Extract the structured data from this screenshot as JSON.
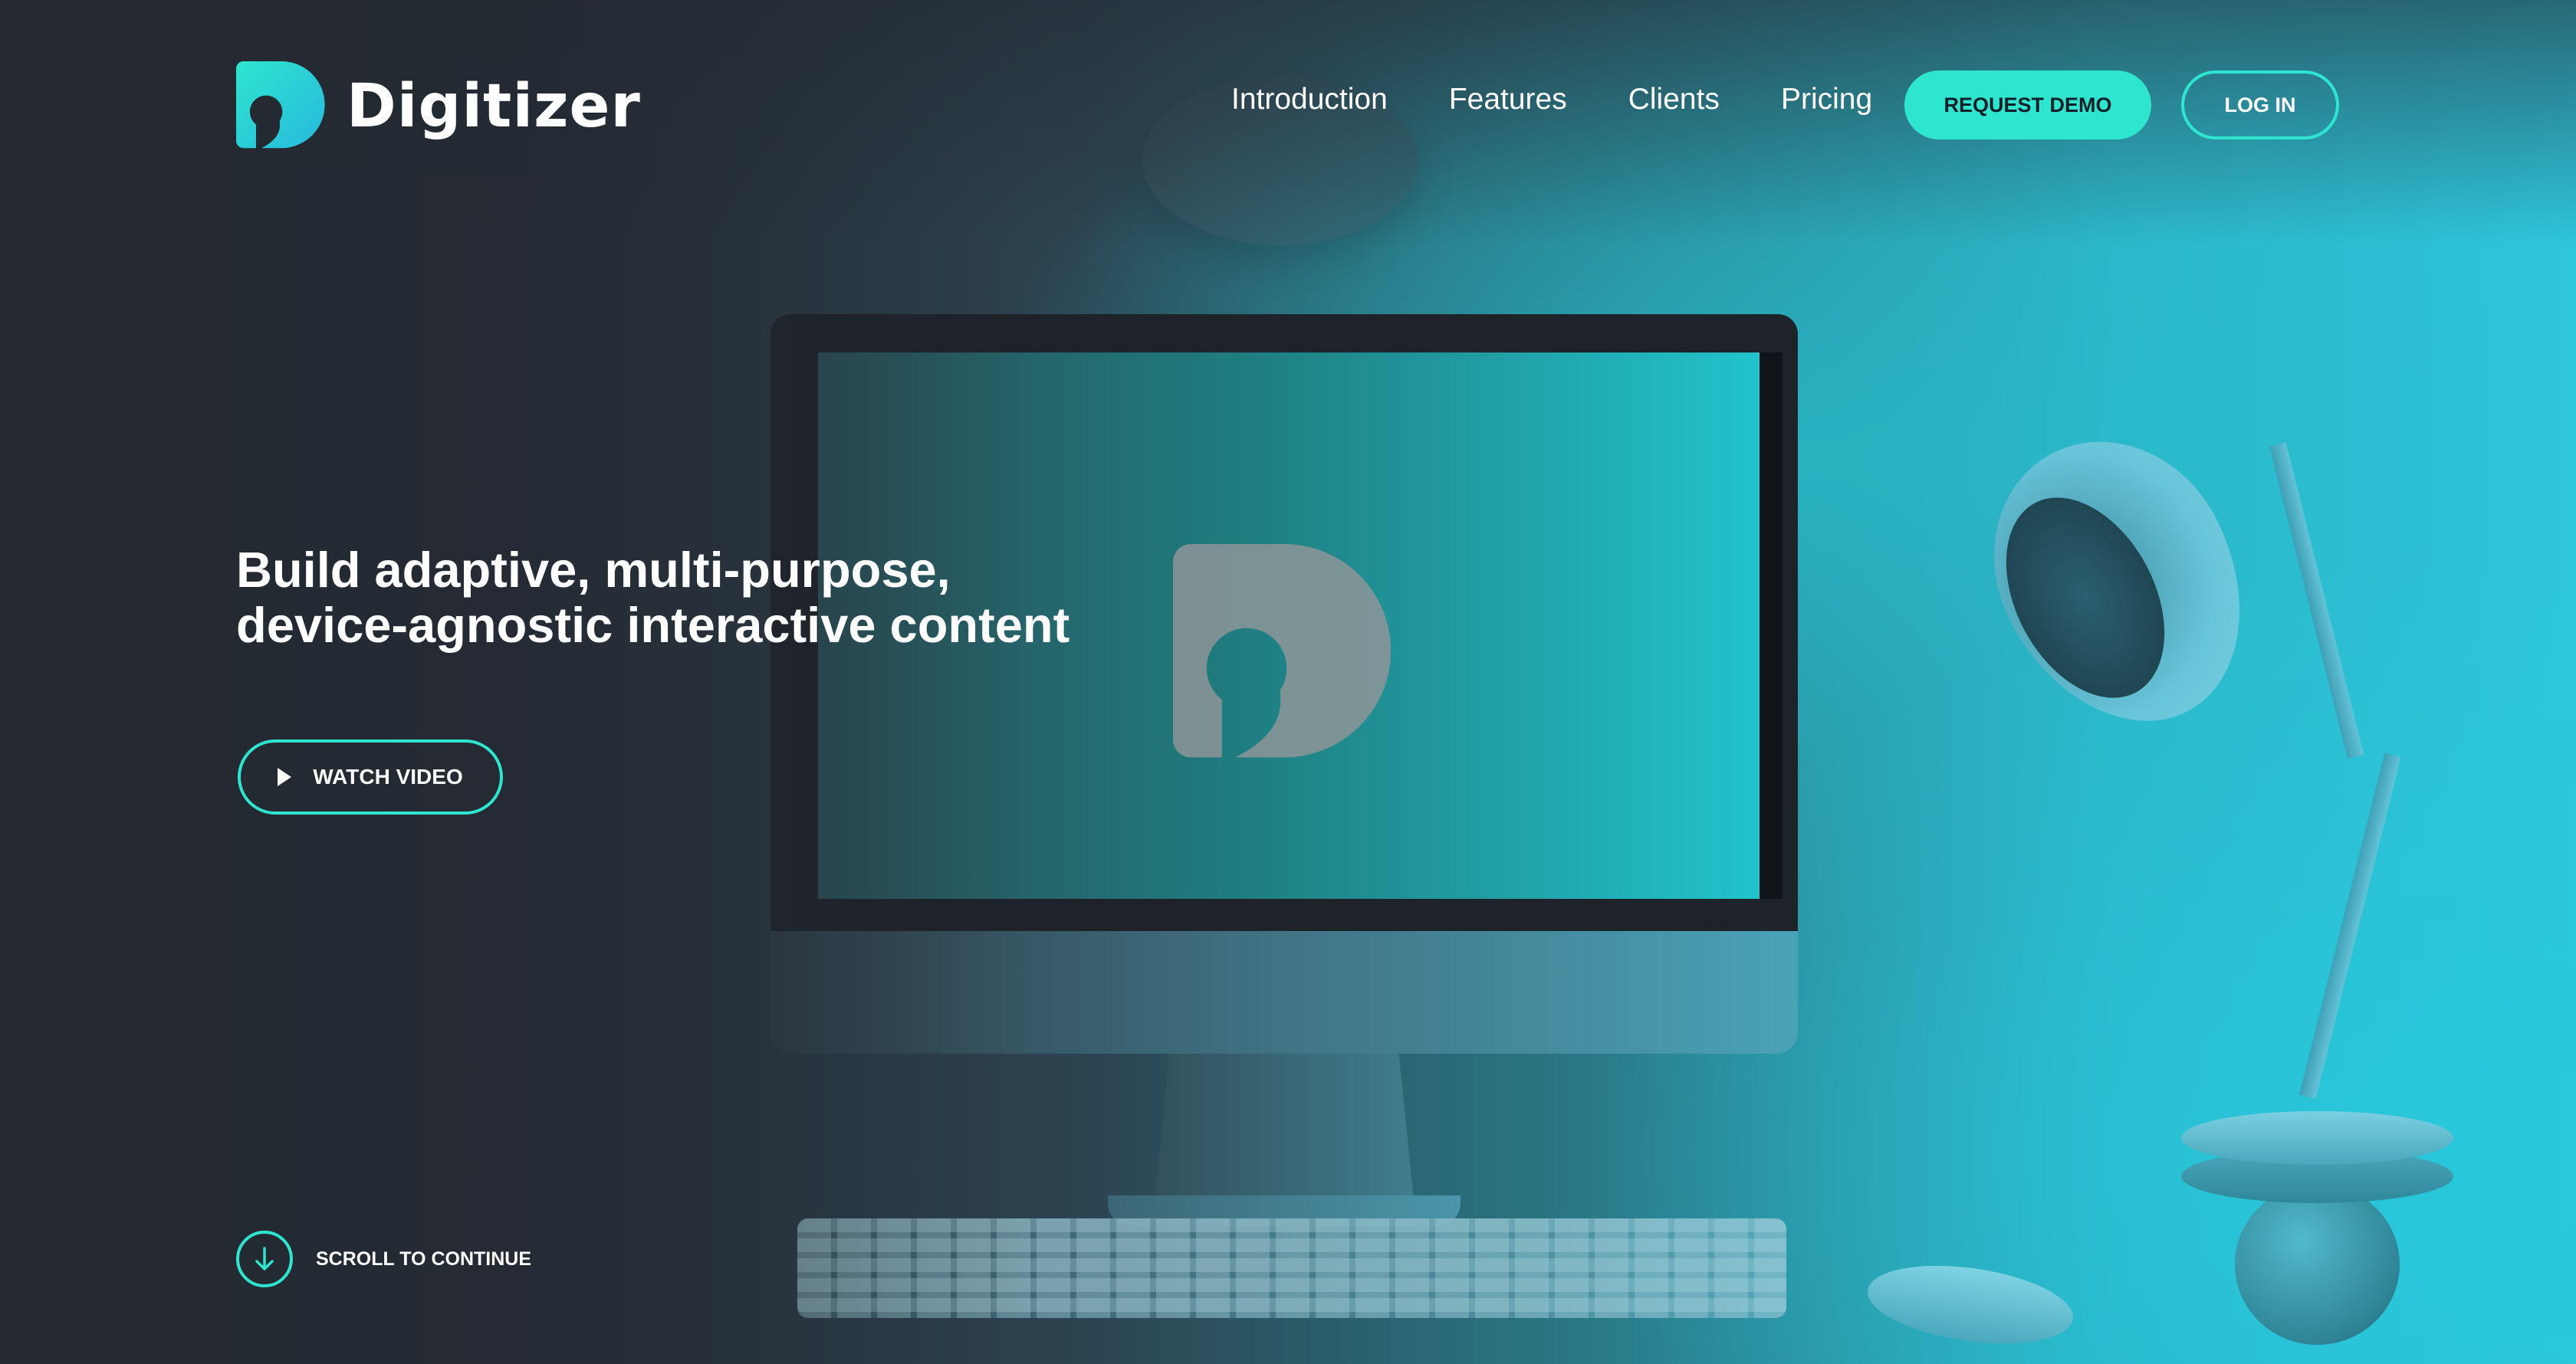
{
  "brand": {
    "name": "Digitizer",
    "accent_color": "#2ee6cf",
    "background_color": "#252a33",
    "logo_icon": "digitizer-logo-icon"
  },
  "nav": {
    "items": [
      {
        "label": "Introduction"
      },
      {
        "label": "Features"
      },
      {
        "label": "Clients"
      },
      {
        "label": "Pricing"
      }
    ],
    "request_demo_label": "REQUEST DEMO",
    "login_label": "LOG IN"
  },
  "hero": {
    "title_line1": "Build adaptive, multi-purpose,",
    "title_line2": "device-agnostic interactive content",
    "watch_video_label": "WATCH VIDEO",
    "play_icon": "play-icon"
  },
  "scroll": {
    "label": "SCROLL TO CONTINUE",
    "icon": "arrow-down-icon"
  }
}
